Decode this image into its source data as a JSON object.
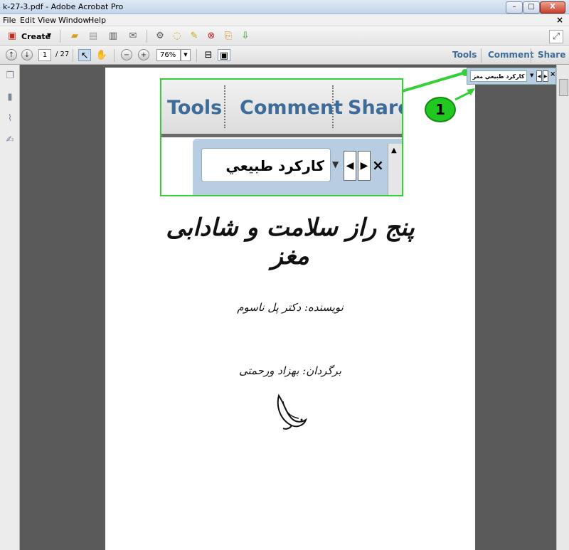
{
  "window": {
    "title": "k-27-3.pdf - Adobe Acrobat Pro",
    "minimize": "–",
    "maximize": "□",
    "close": "X"
  },
  "menu": {
    "items": [
      "File",
      "Edit",
      "View",
      "Window",
      "Help"
    ],
    "close_glyph": "×"
  },
  "toolbar1": {
    "create_label": "Create"
  },
  "toolbar2": {
    "page_current": "1",
    "page_total": "/ 27",
    "zoom_value": "76%"
  },
  "panes": {
    "tools": "Tools",
    "comment": "Comment",
    "share": "Share"
  },
  "search_box": {
    "value": "كاركرد طبيعي مغز"
  },
  "callout": {
    "number": "1"
  },
  "document": {
    "title": "پنج راز سلامت و شادابی مغز",
    "author": "نویسنده: دکتر پل ناسوم",
    "translator": "برگردان: بهزاد ورحمتی"
  },
  "colors": {
    "accent_link": "#3e6c9a",
    "callout_green": "#20c820",
    "panel_blue": "#b7cee2"
  }
}
